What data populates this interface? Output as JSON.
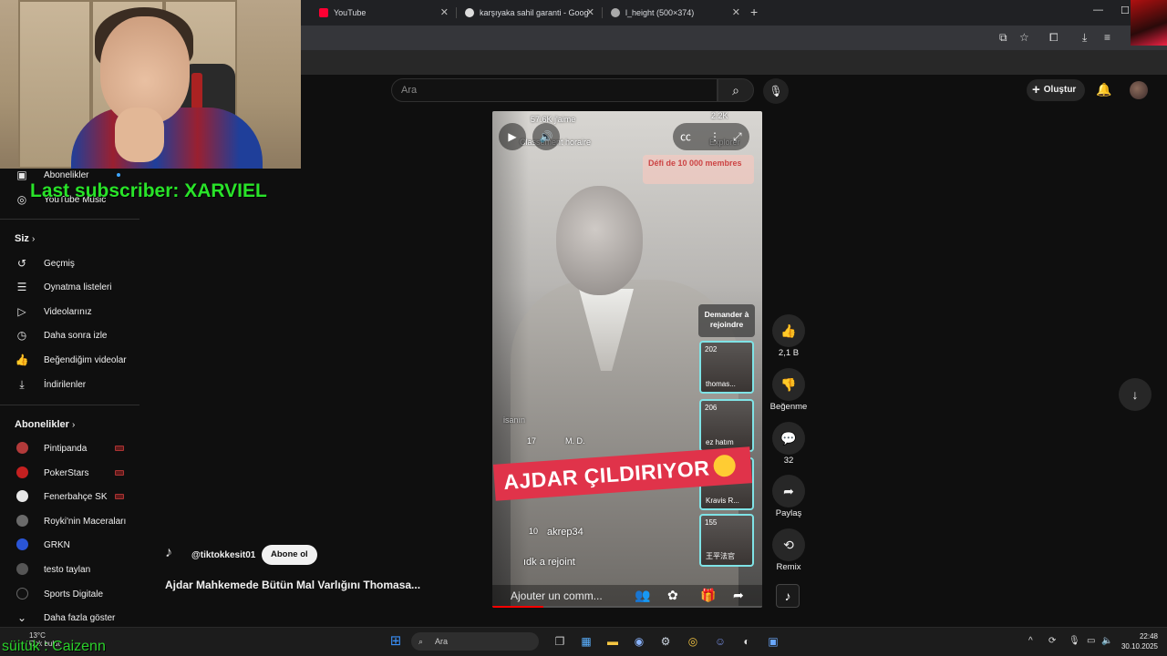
{
  "browser": {
    "tabs": [
      {
        "label": "YouTube",
        "color": "#ff0033"
      },
      {
        "label": "karşıyaka sahil garanti - Google"
      },
      {
        "label": "l_height (500×374)"
      }
    ]
  },
  "header": {
    "search_placeholder": "Ara",
    "create_label": "Oluştur"
  },
  "sidebar": {
    "top_items": [
      {
        "label": "Abonelikler",
        "icon": "subscriptions-icon"
      },
      {
        "label": "YouTube Music",
        "icon": "youtube-music-icon"
      }
    ],
    "you_heading": "Siz",
    "you_items": [
      {
        "label": "Geçmiş",
        "icon": "history-icon"
      },
      {
        "label": "Oynatma listeleri",
        "icon": "playlists-icon"
      },
      {
        "label": "Videolarınız",
        "icon": "your-videos-icon"
      },
      {
        "label": "Daha sonra izle",
        "icon": "watch-later-icon"
      },
      {
        "label": "Beğendiğim videolar",
        "icon": "liked-videos-icon"
      },
      {
        "label": "İndirilenler",
        "icon": "downloads-icon"
      }
    ],
    "subs_heading": "Abonelikler",
    "subscriptions": [
      {
        "label": "Pintipanda",
        "color": "#b23a3a",
        "live": true
      },
      {
        "label": "PokerStars",
        "color": "#c42020",
        "live": true
      },
      {
        "label": "Fenerbahçe SK",
        "color": "#e8e8e8",
        "live": true
      },
      {
        "label": "Royki'nin Maceraları",
        "color": "#6a6a6a",
        "live": false
      },
      {
        "label": "GRKN",
        "color": "#2a55d6",
        "live": false
      },
      {
        "label": "testo taylan",
        "color": "#555555",
        "live": false
      },
      {
        "label": "Sports Digitale",
        "color": "#111111",
        "live": false
      }
    ],
    "show_more": "Daha fazla göster"
  },
  "overlays": {
    "last_subscriber": "Last subscriber: XARVIEL",
    "last_follower": "süitük : Caizenn"
  },
  "player": {
    "likes_count": "57.6K j'aime",
    "viewers": "2.2K",
    "ranking": "Classement horaire",
    "explorer": "Explorer",
    "challenge": "Défi de 10 000 membres",
    "join_request": "Demander à rejoindre",
    "guests": [
      {
        "count": "202",
        "name": "thomas..."
      },
      {
        "count": "206",
        "name": "ez hatım"
      },
      {
        "count": "",
        "name": "Kravis R..."
      },
      {
        "count": "155",
        "name": "王平法官"
      }
    ],
    "banner": "AJDAR ÇILDIRIYOR",
    "chat": [
      {
        "user": "",
        "text": "isanın"
      },
      {
        "user": "17",
        "text": "M. D."
      },
      {
        "user": "10",
        "text": "akrep34"
      },
      {
        "user": "",
        "text": "ıdk a rejoint"
      }
    ],
    "comment_placeholder": "Ajouter un comm...",
    "progress": 0.19
  },
  "actions": {
    "like_count": "2,1 B",
    "dislike_label": "Beğenme",
    "comments_count": "32",
    "share_label": "Paylaş",
    "remix_label": "Remix"
  },
  "video": {
    "channel": "@tiktokkesit01",
    "subscribe_label": "Abone ol",
    "title": "Ajdar Mahkemede Bütün Mal Varlığını Thomasa..."
  },
  "taskbar": {
    "weather_temp": "13°C",
    "weather_desc": "Çok bulut",
    "search_label": "Ara",
    "time": "22:48",
    "date": "30.10.2025"
  }
}
